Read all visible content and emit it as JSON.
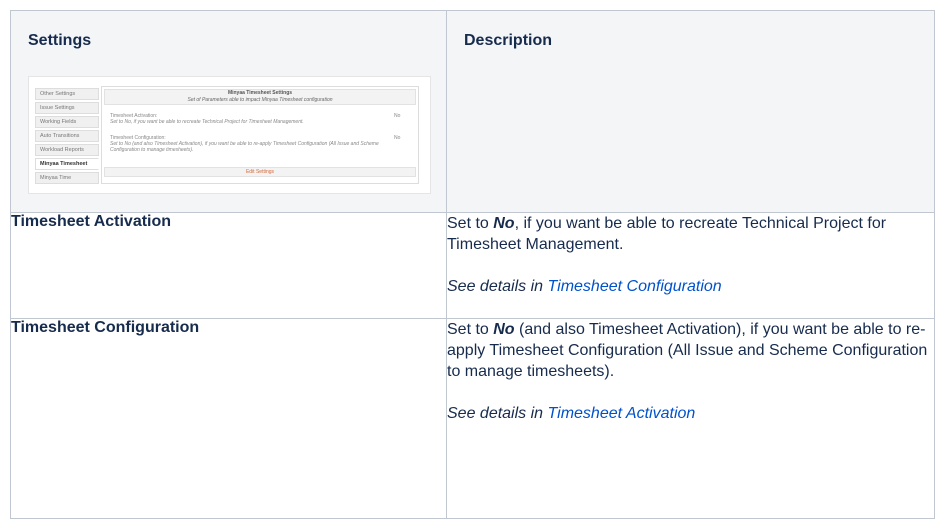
{
  "table": {
    "headers": {
      "settings": "Settings",
      "description": "Description"
    },
    "rows": [
      {
        "name": "Timesheet Activation",
        "desc_prefix": "Set to ",
        "desc_bold": "No",
        "desc_rest": ", if you want be able to recreate Technical Project for Timesheet Management.",
        "details_text": "See details in ",
        "details_link": "Timesheet Configuration"
      },
      {
        "name": "Timesheet Configuration",
        "desc_prefix": "Set to ",
        "desc_bold": "No",
        "desc_rest": " (and also Timesheet Activation), if you want be able to re-apply Timesheet Configuration (All Issue and Scheme Configuration to manage timesheets).",
        "details_text": "See details in ",
        "details_link": "Timesheet Activation"
      }
    ]
  },
  "screenshot": {
    "tabs": [
      "Other Settings",
      "Issue Settings",
      "Working Fields",
      "Auto Transitions",
      "Workload Reports",
      "Minyaa Timesheet",
      "Minyaa Time"
    ],
    "active_tab": 5,
    "panel_title": "Minyaa Timesheet Settings",
    "panel_subtitle": "Set of Parameters able to impact Minyaa Timesheet configuration",
    "option1_label": "Timesheet Activation:",
    "option1_desc": "Set to No, if you want be able to recreate Technical Project for Timesheet Management.",
    "option1_value": "No",
    "option2_label": "Timesheet Configuration:",
    "option2_desc": "Set to No (and also Timesheet Activation), if you want be able to re-apply Timesheet Configuration (All Issue and Scheme Configuration to manage timesheets).",
    "option2_value": "No",
    "edit_button": "Edit Settings"
  }
}
